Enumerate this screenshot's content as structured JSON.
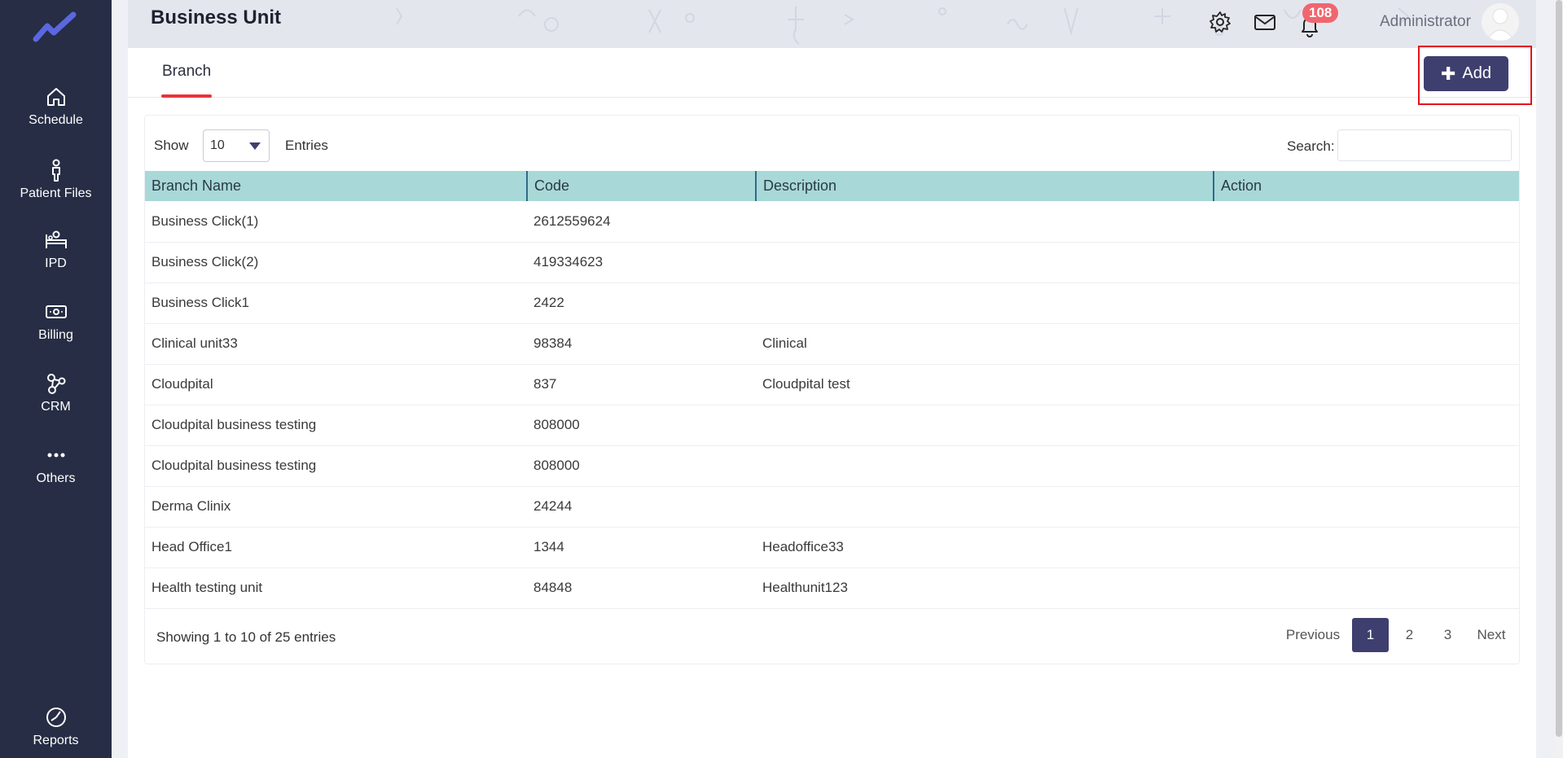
{
  "sidebar": {
    "items": [
      {
        "label": "Schedule",
        "icon": "home-icon"
      },
      {
        "label": "Patient Files",
        "icon": "person-icon"
      },
      {
        "label": "IPD",
        "icon": "bed-icon"
      },
      {
        "label": "Billing",
        "icon": "money-icon"
      },
      {
        "label": "CRM",
        "icon": "network-icon"
      },
      {
        "label": "Others",
        "icon": "more-dots-icon"
      },
      {
        "label": "Reports",
        "icon": "pie-chart-icon"
      }
    ]
  },
  "header": {
    "title": "Business Unit",
    "notification_count": "108",
    "user_name": "Administrator"
  },
  "tabs": [
    {
      "label": "Branch"
    }
  ],
  "add_button": {
    "label": "Add"
  },
  "table_controls": {
    "show_label": "Show",
    "page_size": "10",
    "entries_label": "Entries",
    "search_label": "Search:"
  },
  "table": {
    "columns": [
      "Branch Name",
      "Code",
      "Description",
      "Action"
    ],
    "rows": [
      [
        "Business Click(1)",
        "2612559624",
        "",
        ""
      ],
      [
        "Business Click(2)",
        "419334623",
        "",
        ""
      ],
      [
        "Business Click1",
        "2422",
        "",
        ""
      ],
      [
        "Clinical unit33",
        "98384",
        "Clinical",
        ""
      ],
      [
        "Cloudpital",
        "837",
        "Cloudpital test",
        ""
      ],
      [
        "Cloudpital business testing",
        "808000",
        "",
        ""
      ],
      [
        "Cloudpital business testing",
        "808000",
        "",
        ""
      ],
      [
        "Derma Clinix",
        "24244",
        "",
        ""
      ],
      [
        "Head Office1",
        "1344",
        "Headoffice33",
        ""
      ],
      [
        "Health testing unit",
        "84848",
        "Healthunit123",
        ""
      ]
    ]
  },
  "footer": {
    "showing_text": "Showing 1 to 10 of 25 entries",
    "pagination": {
      "previous": "Previous",
      "pages": [
        "1",
        "2",
        "3"
      ],
      "next": "Next"
    }
  },
  "colors": {
    "sidebar_bg": "#262d44",
    "accent": "#3e3f6e",
    "table_header": "#a8d8d8",
    "tab_underline": "#e8333c",
    "badge": "#f0666f"
  }
}
